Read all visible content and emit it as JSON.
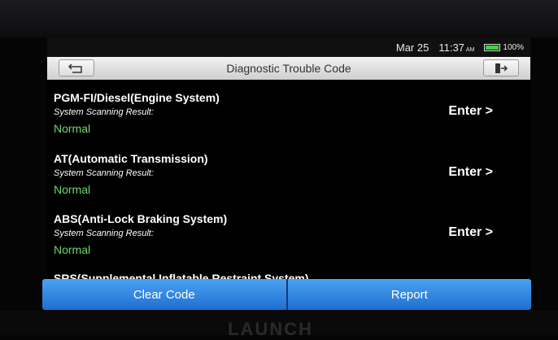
{
  "status_bar": {
    "date": "Mar 25",
    "time": "11:37",
    "ampm": "AM",
    "battery_percent": "100%",
    "battery_level": 1.0,
    "battery_color": "#3ad63a"
  },
  "header": {
    "title": "Diagnostic Trouble Code",
    "back_icon": "back-arrow-icon",
    "exit_icon": "exit-door-icon"
  },
  "systems": [
    {
      "name": "PGM-FI/Diesel(Engine System)",
      "label": "System Scanning Result:",
      "status": "Normal",
      "action": "Enter >"
    },
    {
      "name": "AT(Automatic Transmission)",
      "label": "System Scanning Result:",
      "status": "Normal",
      "action": "Enter >"
    },
    {
      "name": "ABS(Anti-Lock Braking System)",
      "label": "System Scanning Result:",
      "status": "Normal",
      "action": "Enter >"
    }
  ],
  "partial_system_name": "SRS(Supplemental Inflatable Restraint System)",
  "actions": {
    "clear_code": "Clear Code",
    "report": "Report"
  },
  "bezel_brand": "LAUNCH",
  "colors": {
    "status_normal": "#6dd86d",
    "action_button": "#2f86e6"
  }
}
